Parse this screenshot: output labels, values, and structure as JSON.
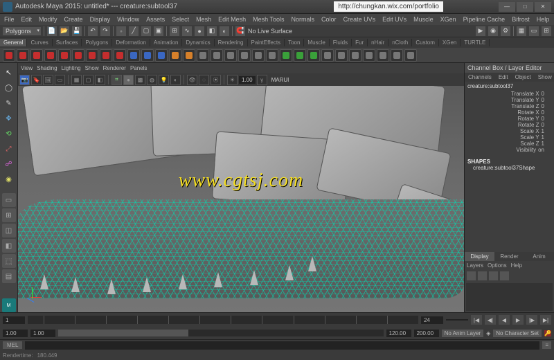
{
  "title": "Autodesk Maya 2015: untitled* --- creature:subtool37",
  "url_box": "http://chungkan.wix.com/portfolio",
  "menu": [
    "File",
    "Edit",
    "Modify",
    "Create",
    "Display",
    "Window",
    "Assets",
    "Select",
    "Mesh",
    "Edit Mesh",
    "Mesh Tools",
    "Normals",
    "Color",
    "Create UVs",
    "Edit UVs",
    "Muscle",
    "XGen",
    "Pipeline Cache",
    "Bifrost",
    "Help"
  ],
  "status": {
    "mode": "Polygons",
    "no_live": "No Live Surface"
  },
  "shelf_tabs": [
    "General",
    "Curves",
    "Surfaces",
    "Polygons",
    "Deformation",
    "Animation",
    "Dynamics",
    "Rendering",
    "PaintEffects",
    "Toon",
    "Muscle",
    "Fluids",
    "Fur",
    "nHair",
    "nCloth",
    "Custom",
    "XGen",
    "TURTLE"
  ],
  "viewport_menu": [
    "View",
    "Shading",
    "Lighting",
    "Show",
    "Renderer",
    "Panels"
  ],
  "viewport_toolbar": {
    "opacity": "1.00",
    "renderer": "MARUI"
  },
  "channel_box": {
    "header": "Channel Box / Layer Editor",
    "tabs": [
      "Channels",
      "Edit",
      "Object",
      "Show"
    ],
    "node": "creature:subtool37",
    "attrs": [
      {
        "label": "Translate X",
        "val": "0"
      },
      {
        "label": "Translate Y",
        "val": "0"
      },
      {
        "label": "Translate Z",
        "val": "0"
      },
      {
        "label": "Rotate X",
        "val": "0"
      },
      {
        "label": "Rotate Y",
        "val": "0"
      },
      {
        "label": "Rotate Z",
        "val": "0"
      },
      {
        "label": "Scale X",
        "val": "1"
      },
      {
        "label": "Scale Y",
        "val": "1"
      },
      {
        "label": "Scale Z",
        "val": "1"
      },
      {
        "label": "Visibility",
        "val": "on"
      }
    ],
    "shapes_label": "SHAPES",
    "shape_node": "creature:subtool37Shape",
    "bottom_tabs": [
      "Display",
      "Render",
      "Anim"
    ],
    "layer_menu": [
      "Layers",
      "Options",
      "Help"
    ]
  },
  "timeline": {
    "start_field": "1",
    "end_field": "24",
    "current": ""
  },
  "range": {
    "min": "1.00",
    "start": "1.00",
    "end": "120.00",
    "max": "200.00",
    "anim_layer": "No Anim Layer",
    "character": "No Character Set"
  },
  "cmd": {
    "mel": "MEL"
  },
  "help": {
    "label": "Rendertime:",
    "value": "180.449"
  },
  "watermark": "www.cgtsj.com"
}
